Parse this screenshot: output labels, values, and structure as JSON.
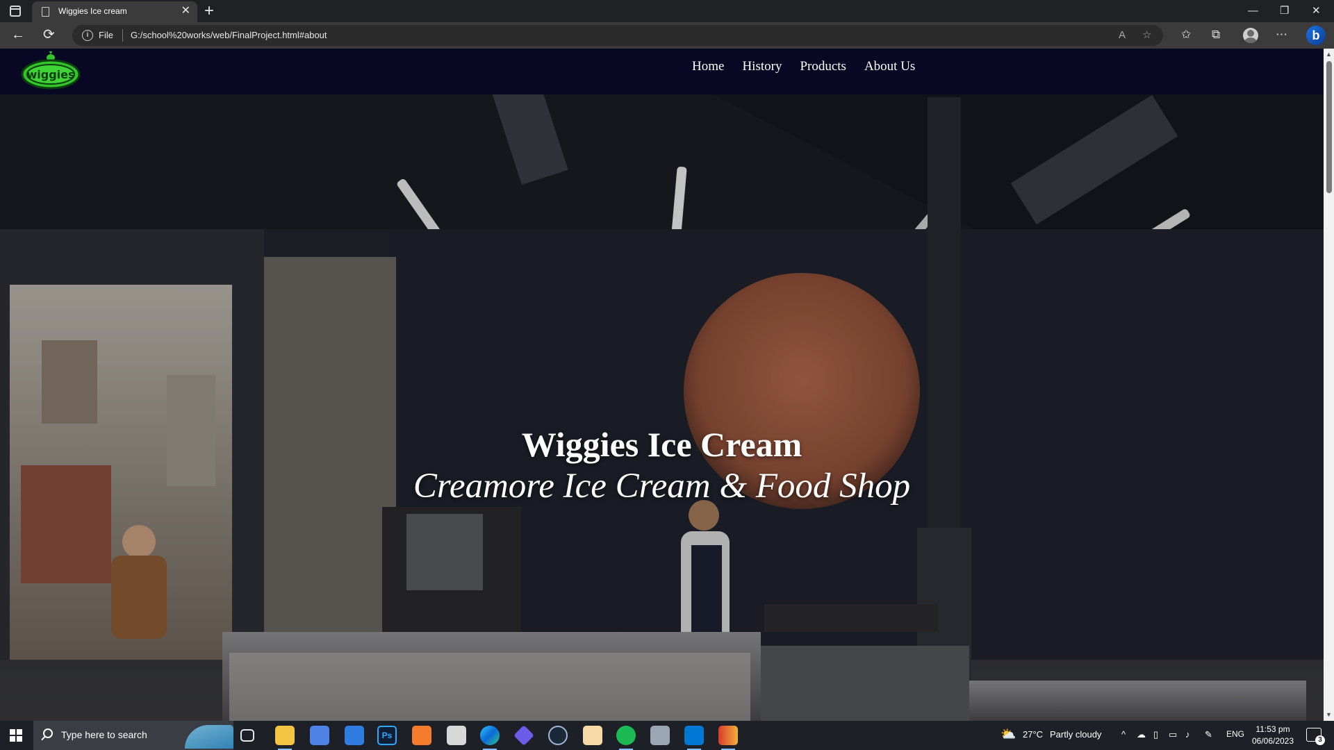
{
  "browser": {
    "tab_title": "Wiggies Ice cream",
    "tab_close": "✕",
    "new_tab": "+",
    "url_scheme": "File",
    "url": "G:/school%20works/web/FinalProject.html#about",
    "window_controls": {
      "minimize": "—",
      "restore": "❐",
      "close": "✕"
    }
  },
  "site": {
    "logo_text": "wiggies",
    "nav": [
      "Home",
      "History",
      "Products",
      "About Us"
    ],
    "hero_title": "Wiggies Ice Cream",
    "hero_subtitle": "Creamore Ice Cream & Food Shop"
  },
  "taskbar": {
    "search_placeholder": "Type here to search",
    "weather_temp": "27°C",
    "weather_text": "Partly cloudy",
    "language": "ENG",
    "time": "11:53 pm",
    "date": "06/06/2023",
    "notification_count": "3"
  },
  "colors": {
    "site_nav_bg": "#080824",
    "logo_green": "#33c42c",
    "taskbar_bg": "#1d2127"
  }
}
